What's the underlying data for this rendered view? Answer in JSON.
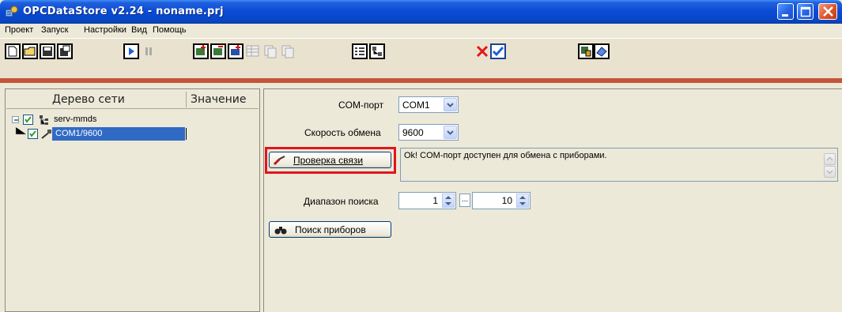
{
  "window": {
    "title": "OPCDataStore v2.24 - noname.prj"
  },
  "menu": {
    "items": [
      "Проект",
      "Запуск",
      "Настройки",
      "Вид",
      "Помощь"
    ]
  },
  "tree": {
    "col_network": "Дерево сети",
    "col_value": "Значение",
    "nodes": [
      {
        "label": "serv-mmds",
        "checked": true
      },
      {
        "label": "COM1/9600",
        "checked": true,
        "selected": true
      }
    ]
  },
  "form": {
    "com_port_label": "COM-порт",
    "com_port_value": "COM1",
    "speed_label": "Скорость обмена",
    "speed_value": "9600",
    "check_button": "Проверка связи",
    "status_text": "Ok! COM-порт доступен для обмена с приборами.",
    "range_label": "Диапазон поиска",
    "range_from": "1",
    "range_sep": "...",
    "range_to": "10",
    "search_button": "Поиск приборов"
  },
  "colors": {
    "titlebar": "#0a4ad4",
    "highlight": "#e3141c",
    "selection": "#316ac5",
    "toolbar_stripe": "#c4553a"
  }
}
